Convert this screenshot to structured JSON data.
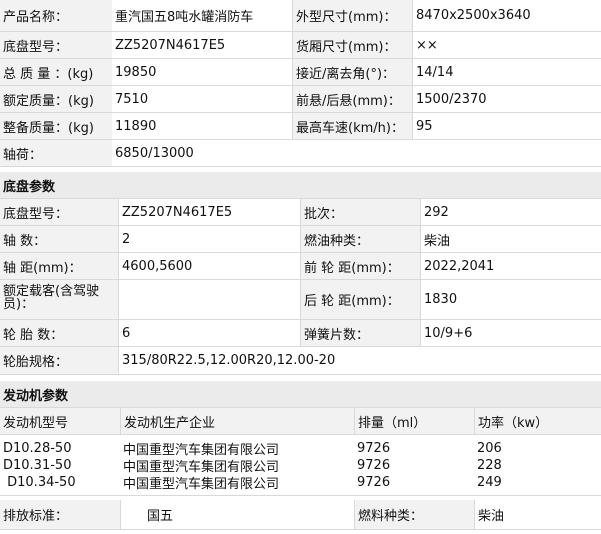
{
  "vehicle": {
    "r1": {
      "l1": "产品名称：",
      "v1": "重汽国五8吨水罐消防车",
      "l2": "外型尺寸(mm)：",
      "v2": "8470x2500x3640"
    },
    "r2": {
      "l1": "底盘型号：",
      "v1": "ZZ5207N4617E5",
      "l2": "货厢尺寸(mm)：",
      "v2": "××"
    },
    "r3": {
      "l1": "总 质 量 ：(kg)",
      "v1": "19850",
      "l2": "接近/离去角(°)：",
      "v2": "14/14"
    },
    "r4": {
      "l1": "额定质量：(kg)",
      "v1": "7510",
      "l2": "前悬/后悬(mm)：",
      "v2": "1500/2370"
    },
    "r5": {
      "l1": "整备质量：(kg)",
      "v1": "11890",
      "l2": "最高车速(km/h)：",
      "v2": "95"
    },
    "r6": {
      "l1": "轴荷：",
      "v1": "6850/13000"
    }
  },
  "chassis": {
    "title": "底盘参数",
    "r1": {
      "l1": "底盘型号：",
      "v1": "ZZ5207N4617E5",
      "l2": "批次：",
      "v2": "292"
    },
    "r2": {
      "l1": "轴 数：",
      "v1": "2",
      "l2": "燃油种类：",
      "v2": "柴油"
    },
    "r3": {
      "l1": "轴 距(mm)：",
      "v1": "4600,5600",
      "l2": "前 轮 距(mm)：",
      "v2": "2022,2041"
    },
    "r4": {
      "l1": "额定载客(含驾驶员)：",
      "v1": "",
      "l2": "后 轮 距(mm)：",
      "v2": "1830"
    },
    "r5": {
      "l1": "轮 胎 数：",
      "v1": "6",
      "l2": "弹簧片数：",
      "v2": "10/9+6"
    },
    "r6": {
      "l1": "轮胎规格：",
      "v1": "315/80R22.5,12.00R20,12.00-20"
    }
  },
  "engine": {
    "title": "发动机参数",
    "headers": {
      "model": "发动机型号",
      "maker": "发动机生产企业",
      "disp": "排量（ml）",
      "power": "功率（kw）"
    },
    "rows": [
      {
        "model": "D10.28-50",
        "maker": "中国重型汽车集团有限公司",
        "disp": "9726",
        "power": "206"
      },
      {
        "model": "D10.31-50",
        "maker": "中国重型汽车集团有限公司",
        "disp": "9726",
        "power": "228"
      },
      {
        "model": " D10.34-50",
        "maker": "中国重型汽车集团有限公司",
        "disp": "9726",
        "power": "249"
      }
    ],
    "emission": {
      "label": "排放标准：",
      "value": "国五",
      "fuel_label": "燃料种类：",
      "fuel_value": "柴油"
    }
  }
}
